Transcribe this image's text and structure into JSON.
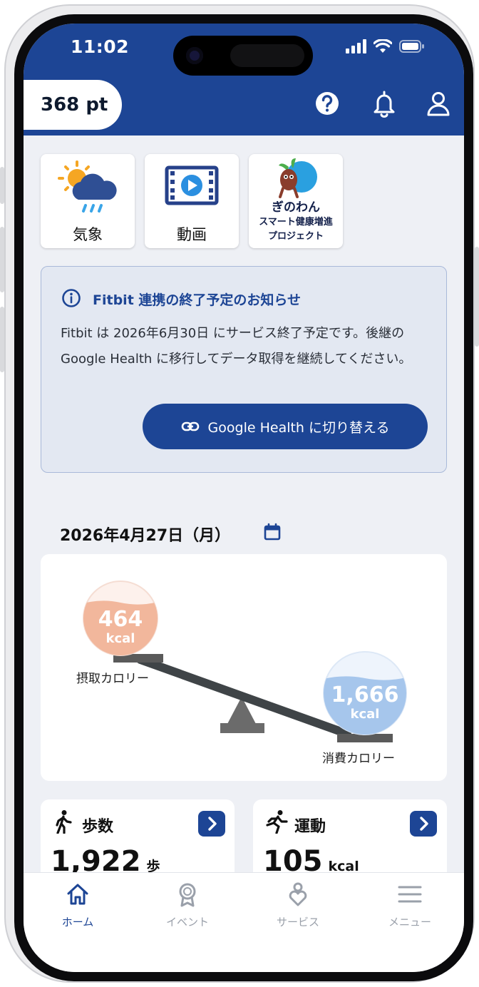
{
  "status_bar": {
    "time": "11:02"
  },
  "header": {
    "points": "368 pt"
  },
  "tiles": [
    {
      "label": "気象",
      "icon": "weather-icon"
    },
    {
      "label": "動画",
      "icon": "video-icon"
    },
    {
      "label_line1": "ぎのわん",
      "label_line2": "スマート健康増進",
      "label_line3": "プロジェクト",
      "icon": "mascot-logo"
    }
  ],
  "notice": {
    "title": "Fitbit 連携の終了予定のお知らせ",
    "body": "Fitbit は 2026年6月30日 にサービス終了予定です。後継の Google Health に移行してデータ取得を継続してください。",
    "button": "Google Health に切り替える"
  },
  "date": {
    "label": "2026年4月27日（月）"
  },
  "calorie_balance": {
    "intake": {
      "value": "464",
      "unit": "kcal",
      "label": "摂取カロリー"
    },
    "burned": {
      "value": "1,666",
      "unit": "kcal",
      "label": "消費カロリー"
    }
  },
  "stats": [
    {
      "title": "歩数",
      "value": "1,922",
      "unit": "歩"
    },
    {
      "title": "運動",
      "value": "105",
      "unit": "kcal"
    }
  ],
  "bottom_nav": [
    {
      "label": "ホーム",
      "active": true
    },
    {
      "label": "イベント",
      "active": false
    },
    {
      "label": "サービス",
      "active": false
    },
    {
      "label": "メニュー",
      "active": false
    }
  ],
  "colors": {
    "primary": "#1d4595",
    "intake": "#f2b79c",
    "burned": "#a6c6ec"
  }
}
